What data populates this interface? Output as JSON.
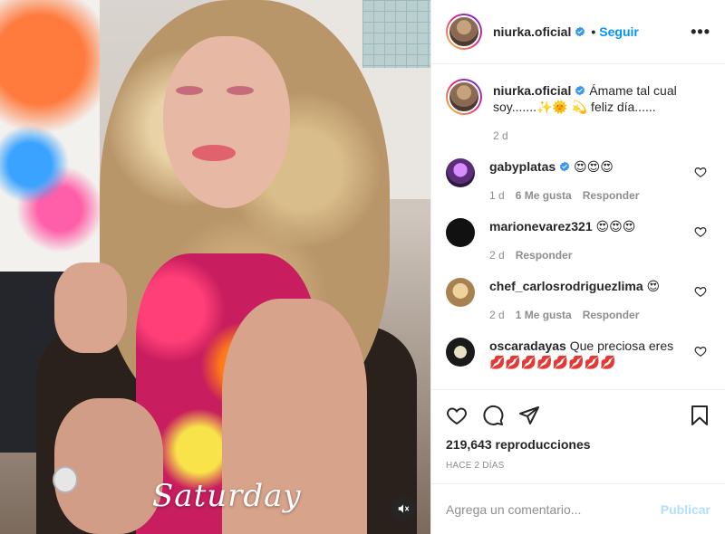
{
  "post": {
    "username": "niurka.oficial",
    "follow_label": "Seguir",
    "dot": "•",
    "more_label": "•••",
    "caption": {
      "username": "niurka.oficial",
      "text": "Ámame tal cual soy.......✨🌞 💫 feliz día......",
      "time": "2 d"
    },
    "media": {
      "overlay_text": "Saturday",
      "mute_icon": "speaker-muted-icon"
    }
  },
  "comments": [
    {
      "username": "gabyplatas",
      "verified": true,
      "text": "😍😍😍",
      "time": "1 d",
      "likes": "6 Me gusta",
      "reply": "Responder"
    },
    {
      "username": "marionevarez321",
      "verified": false,
      "text": "😍😍😍",
      "time": "2 d",
      "likes": "",
      "reply": "Responder"
    },
    {
      "username": "chef_carlosrodriguezlima",
      "verified": false,
      "text": "😍",
      "time": "2 d",
      "likes": "1 Me gusta",
      "reply": "Responder"
    },
    {
      "username": "oscaradayas",
      "verified": false,
      "text": "Que preciosa eres 💋💋💋💋💋💋💋💋",
      "time": "",
      "likes": "",
      "reply": ""
    }
  ],
  "actions": {
    "icons": [
      "heart-icon",
      "comment-icon",
      "share-icon",
      "save-icon"
    ],
    "views": "219,643 reproducciones",
    "posted": "HACE 2 DÍAS"
  },
  "add_comment": {
    "placeholder": "Agrega un comentario...",
    "publish_label": "Publicar"
  },
  "colors": {
    "accent": "#0095f6",
    "publish_disabled": "#b2dffc",
    "muted_text": "#8e8e8e",
    "text": "#262626"
  }
}
